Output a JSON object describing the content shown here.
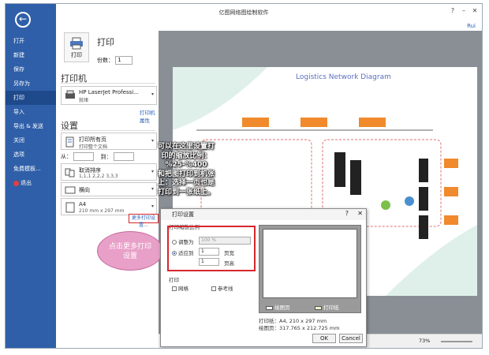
{
  "window": {
    "title": "亿图网络图绘制软件",
    "user": "Rui"
  },
  "sidebar": {
    "items": [
      {
        "label": "打开"
      },
      {
        "label": "新建"
      },
      {
        "label": "保存"
      },
      {
        "label": "另存为"
      },
      {
        "label": "打印"
      },
      {
        "label": "导入"
      },
      {
        "label": "导出 & 发送"
      },
      {
        "label": "关闭"
      },
      {
        "label": "选项"
      },
      {
        "label": "免费模板..."
      },
      {
        "label": "退出"
      }
    ],
    "active_index": 4
  },
  "print_panel": {
    "heading": "打印",
    "print_button": "打印",
    "copies_label": "份数：",
    "copies_value": "1",
    "printer_heading": "打印机",
    "printer_name": "HP LaserJet Professi...",
    "printer_status": "就绪",
    "printer_props_link": "打印机属性",
    "settings_heading": "设置",
    "print_all_title": "打印所有页",
    "print_all_sub": "打印整个文档",
    "from_label": "从：",
    "to_label": "到：",
    "collate_title": "取消排序",
    "collate_sub": "1,1,1  2,2,2  3,3,3",
    "orientation": "横向",
    "paper_title": "A4",
    "paper_sub": "210 mm x 297 mm",
    "more_settings": "更多打印设置..."
  },
  "diagram": {
    "title": "Logistics Network Diagram"
  },
  "annotation": {
    "callout_lines": [
      "可以在这里设置打",
      "印的缩放比例：",
      "%25-%400",
      "和把图打印到机张",
      "上：选择一页也是",
      "打印到一张纸上。"
    ],
    "bubble_lines": [
      "点击更多打印",
      "设置"
    ]
  },
  "dialog": {
    "title": "打印设置",
    "scale_group": "打印缩放比例",
    "adjust_label": "调整为",
    "adjust_value": "100 %",
    "fit_label": "适应到",
    "fit_w_value": "1",
    "fit_w_unit": "页宽",
    "fit_h_value": "1",
    "fit_h_unit": "页高",
    "print_group": "打印",
    "grid_label": "网格",
    "guides_label": "参考线",
    "legend_paper": "绘图页",
    "legend_print": "打印纸",
    "paper_info": "打印纸：A4, 210 x 297 mm",
    "drawing_info": "绘图页：317.765 x 212.725 mm",
    "ok": "OK",
    "cancel": "Cancel"
  },
  "statusbar": {
    "zoom": "73%"
  }
}
